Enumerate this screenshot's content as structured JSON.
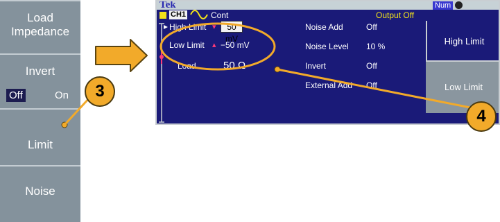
{
  "softkeys": {
    "load_impedance": "Load\nImpedance",
    "invert": "Invert",
    "invert_off": "Off",
    "invert_on": "On",
    "limit": "Limit",
    "noise": "Noise"
  },
  "screen": {
    "brand": "Tek",
    "num_badge": "Num",
    "channel": "CH1",
    "mode": "Cont",
    "output_status": "Output Off",
    "params_left": [
      {
        "label": "High Limit",
        "value": "50 mV"
      },
      {
        "label": "Low Limit",
        "value": "−50 mV"
      },
      {
        "label": "Load",
        "value": "50 Ω"
      }
    ],
    "params_right": [
      {
        "label": "Noise Add",
        "value": "Off"
      },
      {
        "label": "Noise Level",
        "value": "10 %"
      },
      {
        "label": "Invert",
        "value": "Off"
      },
      {
        "label": "External Add",
        "value": "Off"
      }
    ],
    "menu": [
      "High Limit",
      "Low Limit"
    ]
  },
  "callouts": {
    "step3": "3",
    "step4": "4"
  },
  "colors": {
    "screen_bg": "#1a1a78",
    "callout": "#f2aa2a",
    "highlight": "#f2e21a",
    "marker": "#ff3a78"
  }
}
